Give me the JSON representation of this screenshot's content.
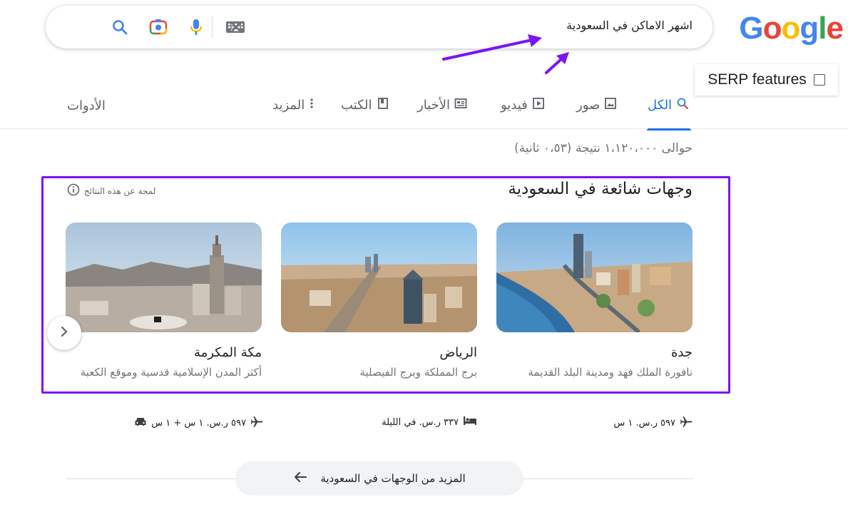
{
  "logo": {
    "letters": [
      "G",
      "o",
      "o",
      "g",
      "l",
      "e"
    ],
    "colors": [
      "#4285F4",
      "#EA4335",
      "#FBBC05",
      "#4285F4",
      "#34A853",
      "#EA4335"
    ]
  },
  "search": {
    "query": "اشهر الاماكن في السعودية"
  },
  "serp_widget": {
    "label": "SERP features"
  },
  "tabs": [
    {
      "label": "الكل",
      "icon": "search-icon"
    },
    {
      "label": "صور",
      "icon": "image-icon"
    },
    {
      "label": "فيديو",
      "icon": "play-icon"
    },
    {
      "label": "الأخبار",
      "icon": "news-icon"
    },
    {
      "label": "الكتب",
      "icon": "book-icon"
    },
    {
      "label": "المزيد",
      "icon": "more-vert-icon"
    }
  ],
  "tools_label": "الأدوات",
  "stats": "حوالى ١،١٢٠،٠٠٠ نتيجة (٠،٥٣ ثانية)",
  "section": {
    "title": "وجهات شائعة في السعودية",
    "about": "لمحة عن هذه النتائج"
  },
  "cards": [
    {
      "name": "جدة",
      "desc": "نافورة الملك فهد ومدينة البلد القديمة",
      "travel": "٥٩٧ ر.س. ١ س",
      "travel_icon": "flight-icon"
    },
    {
      "name": "الرياض",
      "desc": "برج المملكة وبرج الفيصلية",
      "travel": "٣٣٧ ر.س. في الليلة",
      "travel_icon": "hotel-icon"
    },
    {
      "name": "مكة المكرمة",
      "desc": "أكثر المدن الإسلامية قدسية وموقع الكعبة",
      "travel": "٥٩٧ ر.س. ١ س + ١ س",
      "travel_icon": "flight-icon"
    }
  ],
  "more_button": {
    "label": "المزيد من الوجهات في السعودية"
  },
  "accent": "#7b14f5"
}
